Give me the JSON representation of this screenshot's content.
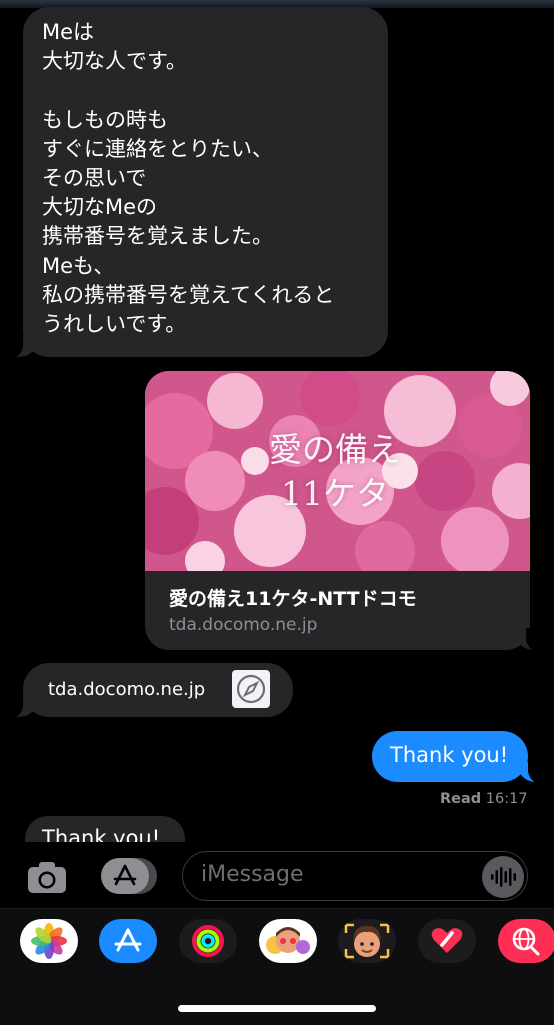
{
  "messages": {
    "received_long": {
      "text": "Meは\n大切な人です。\n\nもしもの時も\nすぐに連絡をとりたい、\nその思いで\n大切なMeの\n携帯番号を覚えました。\nMeも、\n私の携帯番号を覚えてくれると\nうれしいです。"
    },
    "link_preview": {
      "image_caption_line1": "愛の備え",
      "image_caption_line2": "11ケタ",
      "title": "愛の備え11ケタ-NTTドコモ",
      "domain": "tda.docomo.ne.jp"
    },
    "received_link": {
      "text": "tda.docomo.ne.jp",
      "icon": "compass-safari-icon"
    },
    "sent": {
      "text": "Thank you!",
      "status_label": "Read",
      "time": "16:17"
    },
    "received_partial": {
      "text": "Thank you!"
    }
  },
  "input_bar": {
    "placeholder": "iMessage",
    "camera_icon": "camera-icon",
    "apps_icon": "app-store-icon",
    "audio_icon": "waveform-icon"
  },
  "app_drawer": {
    "apps": [
      {
        "name": "photos",
        "icon": "photos-icon",
        "bg": "#ffffff"
      },
      {
        "name": "app-store",
        "icon": "app-store-icon",
        "bg": "#1a8cff"
      },
      {
        "name": "fitness",
        "icon": "activity-rings-icon",
        "bg": "#1c1c1e"
      },
      {
        "name": "memoji-stickers",
        "icon": "memoji-stickers-icon",
        "bg": "#ffffff"
      },
      {
        "name": "memoji",
        "icon": "memoji-icon",
        "bg": "#1c1c1e"
      },
      {
        "name": "digital-touch",
        "icon": "heart-touch-icon",
        "bg": "#1c1c1e"
      },
      {
        "name": "images-search",
        "icon": "globe-search-icon",
        "bg": "#ff2e55"
      }
    ]
  },
  "colors": {
    "background": "#000000",
    "received_bubble": "#262629",
    "sent_bubble": "#1a8cff",
    "secondary_text": "#8e8e93"
  }
}
